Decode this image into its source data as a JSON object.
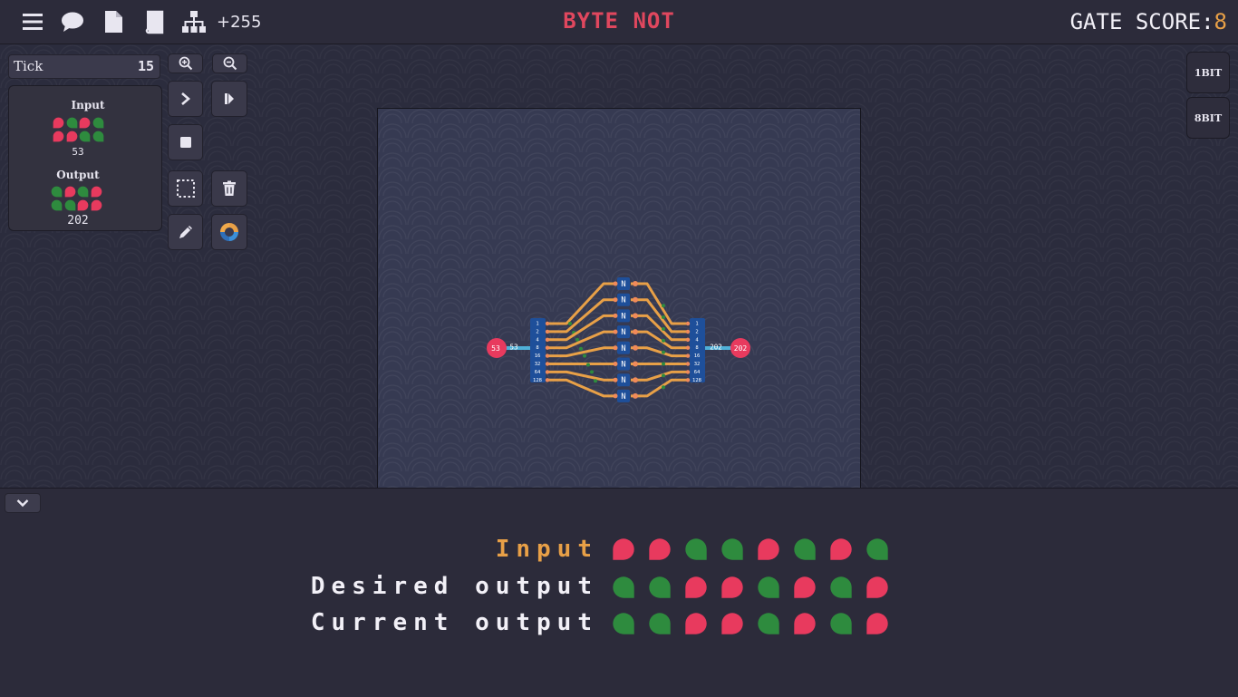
{
  "topbar": {
    "icons": [
      "menu-icon",
      "chat-icon",
      "file-icon",
      "book-icon",
      "tree-icon"
    ],
    "levels_count": "+255",
    "level_title": "BYTE NOT",
    "gate_score_label": "GATE SCORE:",
    "gate_score_value": "8"
  },
  "colors": {
    "title": "#e0475e",
    "bit_on": "#2e8b3e",
    "bit_off": "#e83a5e",
    "accent": "#e8a047",
    "wire": "#e8a047",
    "gate": "#1e4f9a"
  },
  "tick": {
    "label": "Tick",
    "value": "15"
  },
  "io_panel": {
    "input_title": "Input",
    "input_bits": [
      0,
      1,
      0,
      1,
      0,
      0,
      1,
      1
    ],
    "input_value": "53",
    "output_title": "Output",
    "output_bits": [
      1,
      0,
      1,
      0,
      1,
      1,
      0,
      0
    ],
    "output_value": "202"
  },
  "tools": [
    "zoom-in-icon",
    "zoom-out-icon",
    "step-icon",
    "play-icon",
    "stop-icon",
    "select-icon",
    "trash-icon",
    "pencil-icon",
    "color-wheel-icon"
  ],
  "bit_buttons": {
    "one": "1BIT",
    "eight": "8BIT"
  },
  "circuit": {
    "input_node": "53",
    "input_bus": "53",
    "output_node": "202",
    "output_bus": "202",
    "split_labels": [
      "1",
      "2",
      "4",
      "8",
      "16",
      "32",
      "64",
      "128"
    ],
    "gate_label": "N",
    "gate_count": 8
  },
  "bottom": {
    "rows": [
      {
        "label": "Input",
        "bits": [
          0,
          0,
          1,
          1,
          0,
          1,
          0,
          1
        ]
      },
      {
        "label": "Desired output",
        "bits": [
          1,
          1,
          0,
          0,
          1,
          0,
          1,
          0
        ]
      },
      {
        "label": "Current output",
        "bits": [
          1,
          1,
          0,
          0,
          1,
          0,
          1,
          0
        ]
      }
    ]
  }
}
